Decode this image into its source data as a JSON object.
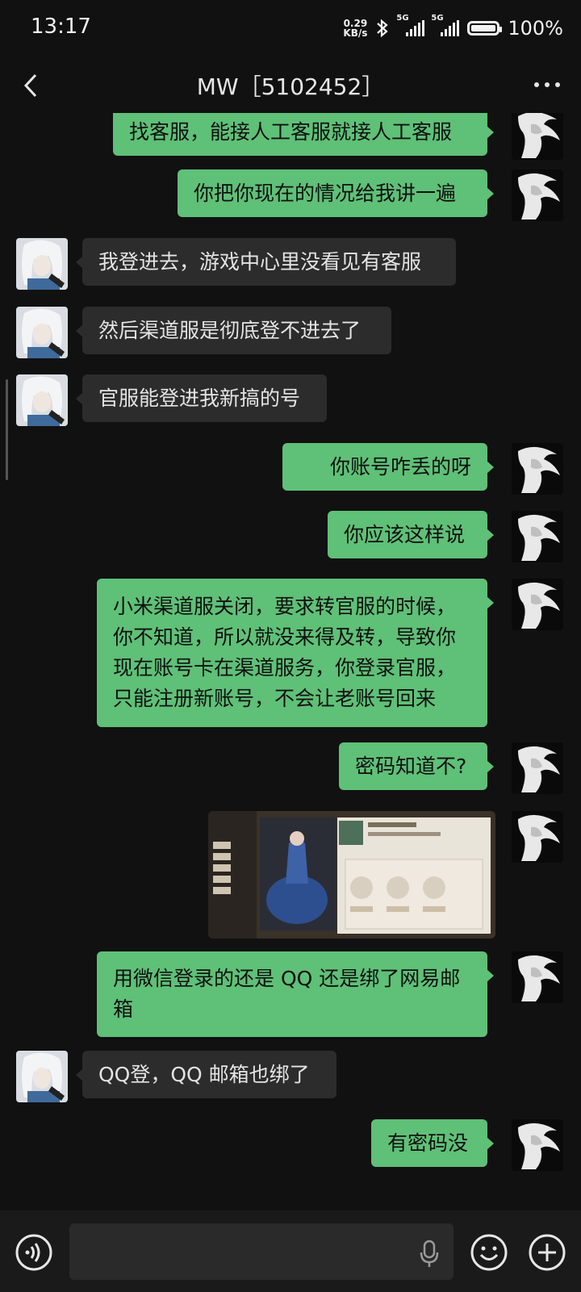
{
  "status": {
    "time": "13:17",
    "net_speed": "0.29",
    "net_unit": "KB/s",
    "sim1": "5G",
    "sim2": "5G",
    "battery": "100%"
  },
  "header": {
    "title": "MW［5102452］"
  },
  "messages": [
    {
      "side": "out",
      "text": "找客服，能接人工客服就接人工客服"
    },
    {
      "side": "out",
      "text": "你把你现在的情况给我讲一遍"
    },
    {
      "side": "in",
      "text": "我登进去，游戏中心里没看见有客服"
    },
    {
      "side": "in",
      "text": "然后渠道服是彻底登不进去了"
    },
    {
      "side": "in",
      "text": "官服能登进我新搞的号"
    },
    {
      "side": "out",
      "text": "你账号咋丢的呀"
    },
    {
      "side": "out",
      "text": "你应该这样说"
    },
    {
      "side": "out",
      "lines": [
        "小米渠道服关闭，要求转官服的时候，",
        "你不知道，所以就没来得及转，导致你",
        "现在账号卡在渠道服务，你登录官服，",
        "只能注册新账号，不会让老账号回来"
      ]
    },
    {
      "side": "out",
      "text": "密码知道不?"
    },
    {
      "side": "out",
      "type": "image",
      "image_desc": "game-screenshot"
    },
    {
      "side": "out",
      "lines": [
        "用微信登录的还是 QQ 还是绑了网易邮",
        "箱"
      ]
    },
    {
      "side": "in",
      "text": "QQ登，QQ 邮箱也绑了"
    },
    {
      "side": "out",
      "text": "有密码没"
    }
  ],
  "input": {
    "placeholder": ""
  },
  "colors": {
    "background": "#111111",
    "outgoing": "#5fc077",
    "incoming": "#2c2c2c"
  },
  "icons": {
    "back": "chevron-left-icon",
    "more": "more-dots-icon",
    "voice": "voice-icon",
    "mic": "mic-icon",
    "emoji": "emoji-icon",
    "plus": "plus-icon"
  }
}
